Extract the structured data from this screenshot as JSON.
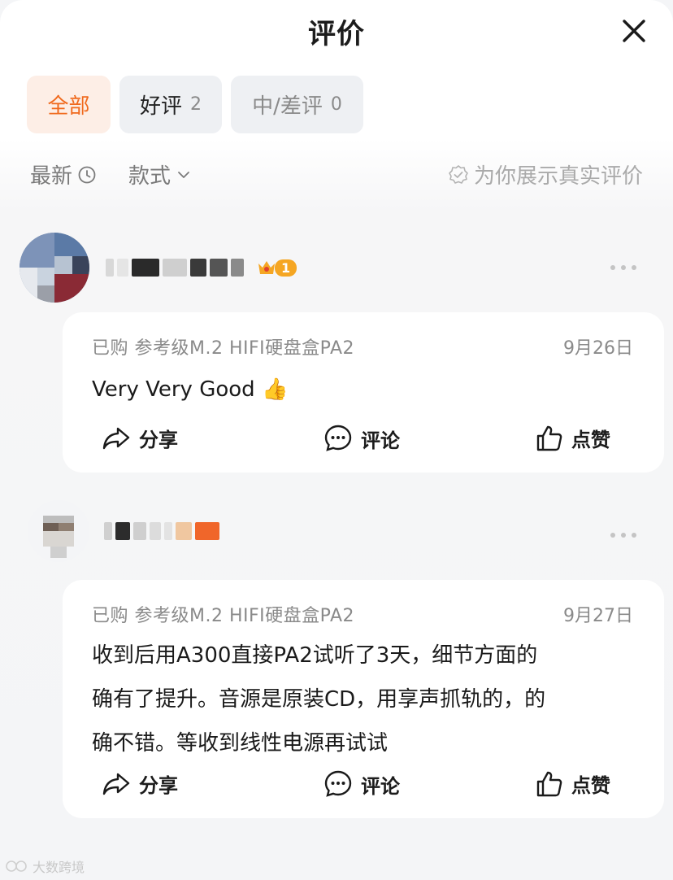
{
  "header": {
    "title": "评价"
  },
  "tabs": [
    {
      "label": "全部",
      "count": ""
    },
    {
      "label": "好评",
      "count": "2"
    },
    {
      "label": "中/差评",
      "count": "0"
    }
  ],
  "filters": {
    "newest": "最新",
    "style": "款式",
    "real_reviews": "为你展示真实评价"
  },
  "reviews": [
    {
      "user_badge": "1",
      "purchase_info": "已购 参考级M.2 HIFI硬盘盒PA2",
      "date": "9月26日",
      "text": "Very Very Good 👍",
      "share": "分享",
      "comment": "评论",
      "like": "点赞"
    },
    {
      "purchase_info": "已购 参考级M.2 HIFI硬盘盒PA2",
      "date": "9月27日",
      "text_lines": [
        "收到后用A300直接PA2试听了3天，细节方面的",
        "确有了提升。音源是原装CD，用享声抓轨的，的",
        "确不错。等收到线性电源再试试"
      ],
      "share": "分享",
      "comment": "评论",
      "like": "点赞"
    }
  ],
  "watermark": "大数跨境",
  "colors": {
    "accent": "#f06a1e",
    "accent_bg": "#fdeee6",
    "badge": "#f5a623"
  }
}
